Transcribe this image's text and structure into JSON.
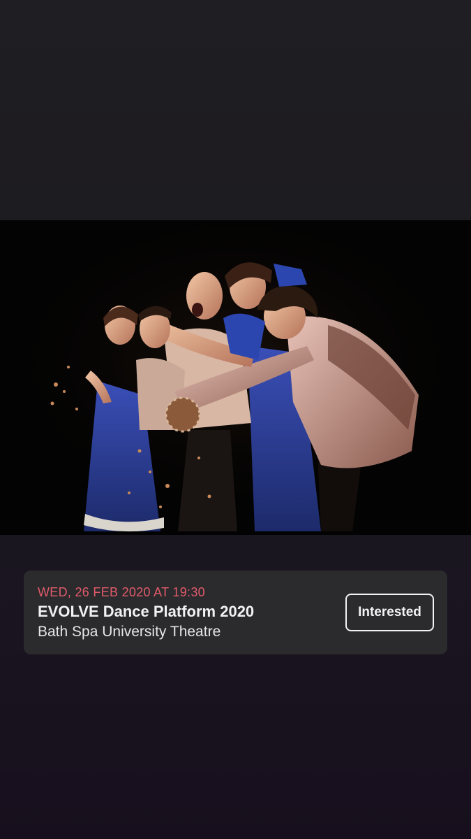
{
  "event": {
    "date_time": "WED, 26 FEB 2020 AT 19:30",
    "title": "EVOLVE Dance Platform 2020",
    "venue": "Bath Spa University Theatre",
    "interested_label": "Interested"
  },
  "photo": {
    "description_icon": "dance-performance-photo"
  },
  "colors": {
    "background": "#1d1b20",
    "card": "#2b2b2e",
    "date_accent": "#e15b6a",
    "text": "#f2f2f2"
  }
}
